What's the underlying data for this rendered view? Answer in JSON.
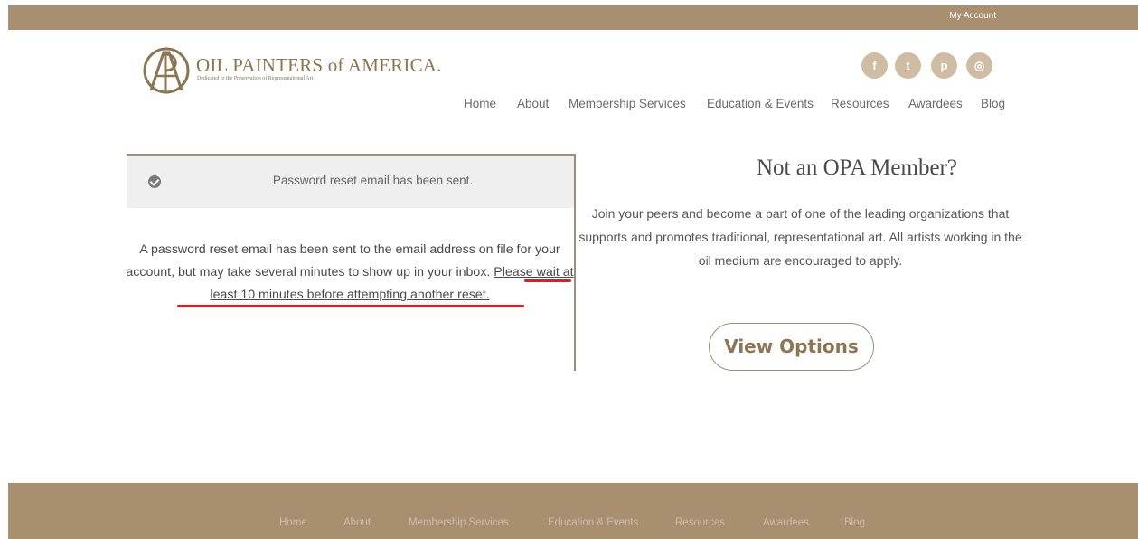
{
  "topbar": {
    "account_label": "My Account"
  },
  "logo": {
    "name": "OIL PAINTERS of AMERICA.",
    "tagline": "Dedicated to the Preservation of Representational Art"
  },
  "social": [
    {
      "icon": "facebook-icon",
      "glyph": "f"
    },
    {
      "icon": "twitter-icon",
      "glyph": "t"
    },
    {
      "icon": "pinterest-icon",
      "glyph": "p"
    },
    {
      "icon": "instagram-icon",
      "glyph": "◎"
    }
  ],
  "nav": [
    "Home",
    "About",
    "Membership Services",
    "Education & Events",
    "Resources",
    "Awardees",
    "Blog"
  ],
  "notice": {
    "text": "Password reset email has been sent."
  },
  "message": {
    "part1": "A password reset email has been sent to the email address on file for your account, but may take several minutes to show up in your inbox. ",
    "part2": "Please wait at least 10 minutes before attempting another reset."
  },
  "promo": {
    "title": "Not an OPA Member?",
    "text": "Join your peers and become a part of one of the leading organizations that supports and promotes traditional, representational art. All artists working in the oil medium are encouraged to apply.",
    "button": "View Options"
  },
  "footer_nav": [
    "Home",
    "About",
    "Membership Services",
    "Education & Events",
    "Resources",
    "Awardees",
    "Blog"
  ],
  "colors": {
    "brand": "#a88f6f",
    "accent_text": "#8c7552",
    "highlight": "#e21c23"
  }
}
